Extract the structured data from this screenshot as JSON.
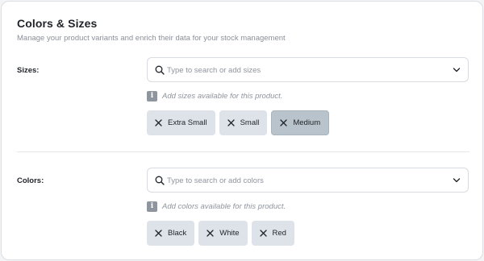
{
  "header": {
    "title": "Colors & Sizes",
    "subtitle": "Manage your product variants and enrich their data for your stock management"
  },
  "sizes": {
    "label": "Sizes:",
    "placeholder": "Type to search or add sizes",
    "hint": "Add sizes available for this product.",
    "chips": [
      "Extra Small",
      "Small",
      "Medium"
    ],
    "active_chip": "Medium"
  },
  "colors": {
    "label": "Colors:",
    "placeholder": "Type to search or add colors",
    "hint": "Add colors available for this product.",
    "chips": [
      "Black",
      "White",
      "Red"
    ]
  },
  "icons": {
    "search": "search-icon",
    "dropdown": "chevron-down-icon",
    "info": "info-icon",
    "remove": "close-icon"
  },
  "colors_theme": {
    "chip_bg": "#dde3e8",
    "chip_active_bg": "#b9c3cb",
    "muted_text": "#8f959e"
  }
}
